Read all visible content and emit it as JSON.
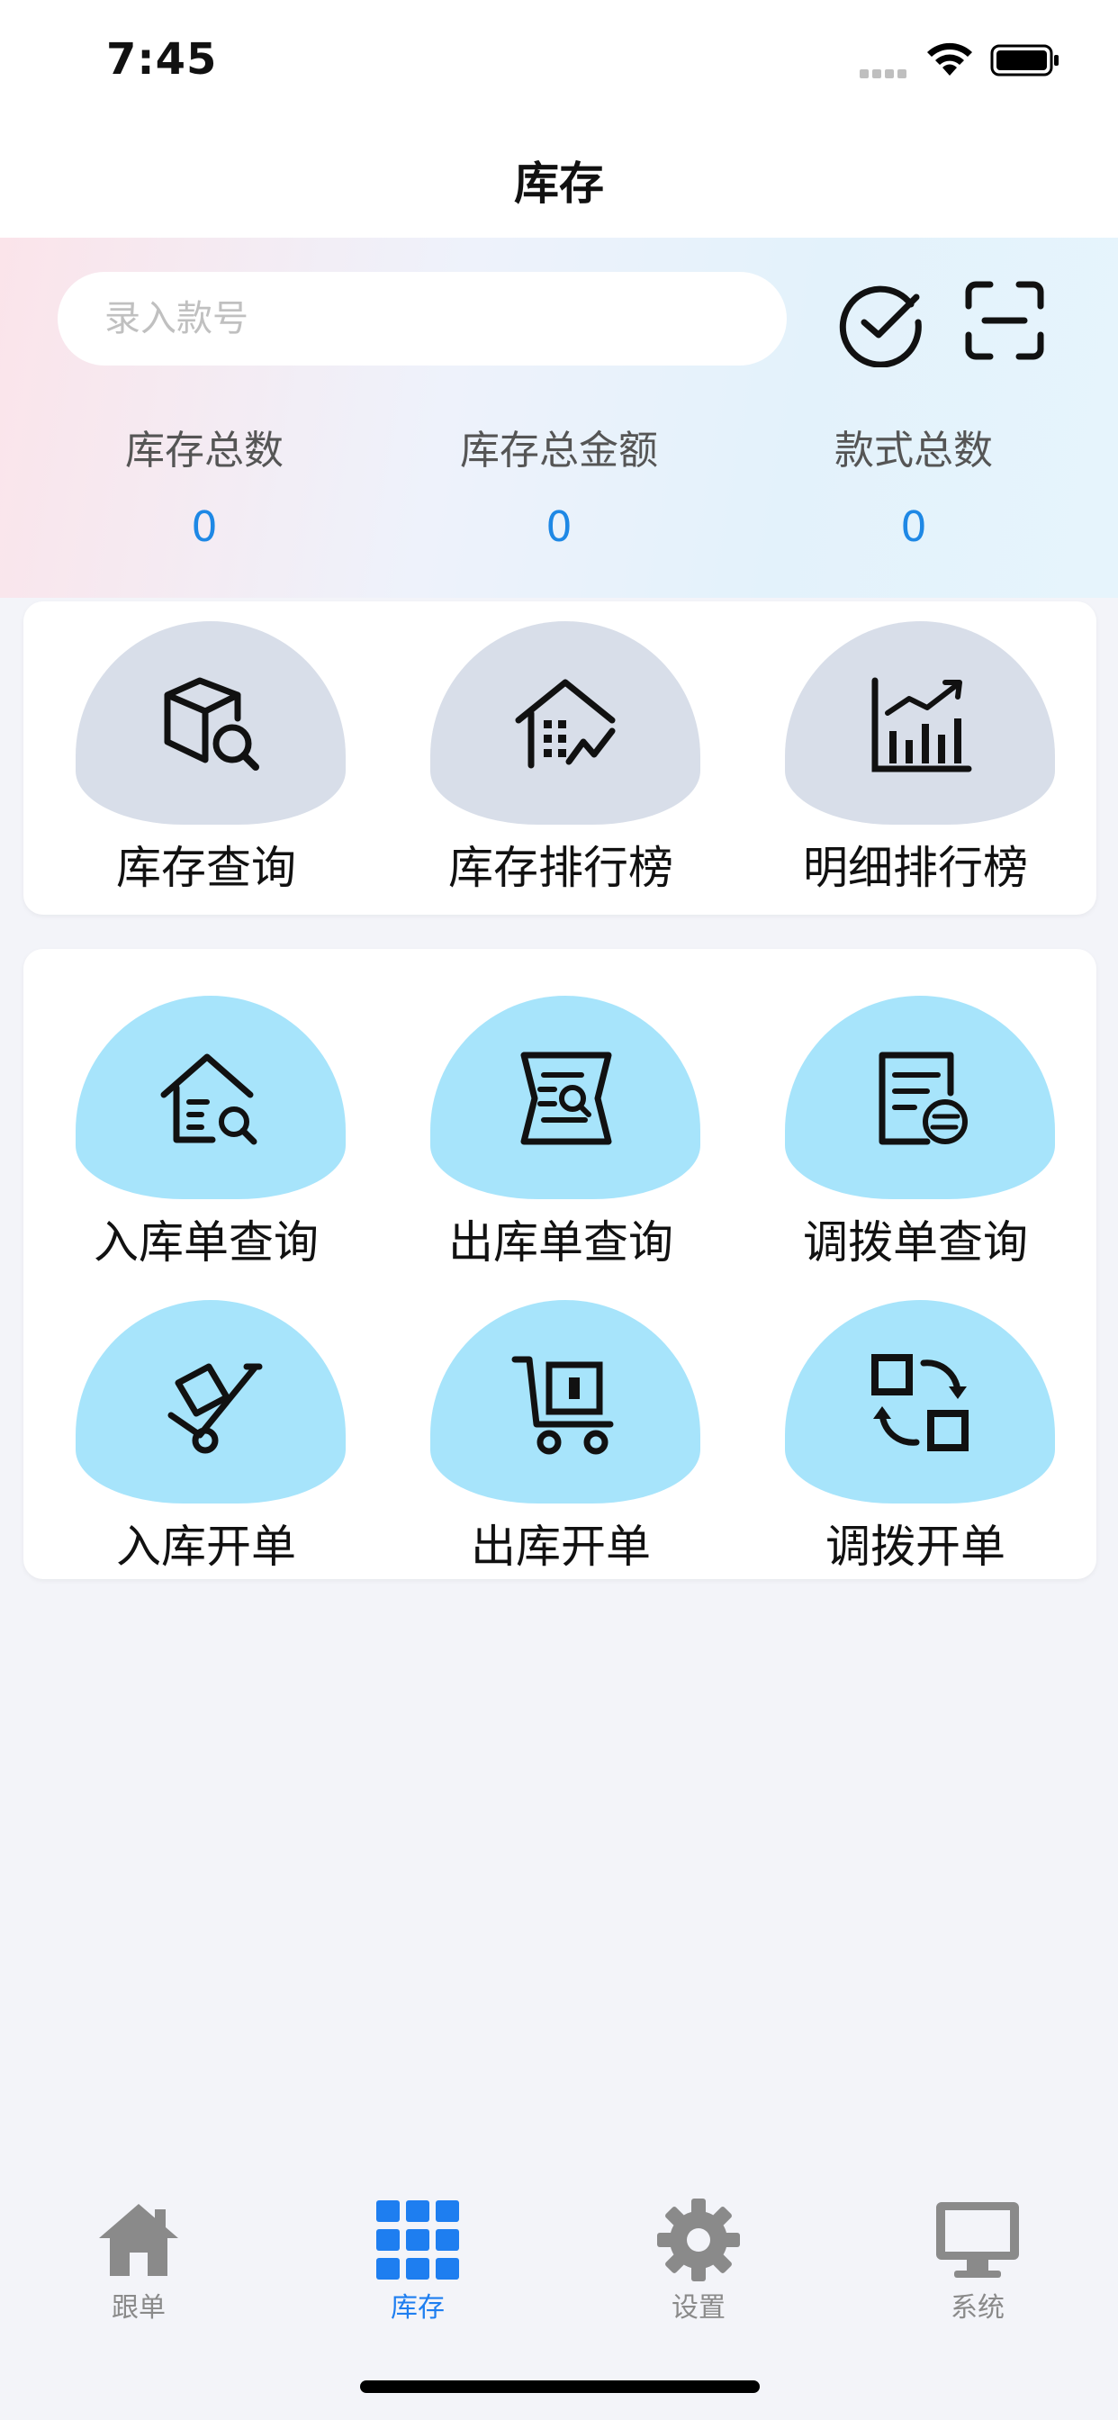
{
  "status_bar": {
    "time": "7:45"
  },
  "nav": {
    "title": "库存"
  },
  "search": {
    "placeholder": "录入款号",
    "value": ""
  },
  "actions": {
    "confirm_icon": "check-circle-icon",
    "scan_icon": "scan-icon"
  },
  "stats": [
    {
      "label": "库存总数",
      "value": "0"
    },
    {
      "label": "库存总金额",
      "value": "0"
    },
    {
      "label": "款式总数",
      "value": "0"
    }
  ],
  "section_reports": {
    "items": [
      {
        "label": "库存查询",
        "icon": "box-search-icon"
      },
      {
        "label": "库存排行榜",
        "icon": "building-chart-icon"
      },
      {
        "label": "明细排行榜",
        "icon": "bar-chart-icon"
      }
    ]
  },
  "section_orders": {
    "items": [
      {
        "label": "入库单查询",
        "icon": "house-search-icon"
      },
      {
        "label": "出库单查询",
        "icon": "document-search-icon"
      },
      {
        "label": "调拨单查询",
        "icon": "document-transfer-icon"
      },
      {
        "label": "入库开单",
        "icon": "hand-truck-icon"
      },
      {
        "label": "出库开单",
        "icon": "cart-icon"
      },
      {
        "label": "调拨开单",
        "icon": "swap-icon"
      }
    ]
  },
  "tab_bar": {
    "items": [
      {
        "label": "跟单",
        "icon": "home-icon",
        "active": false
      },
      {
        "label": "库存",
        "icon": "grid-icon",
        "active": true
      },
      {
        "label": "设置",
        "icon": "gear-icon",
        "active": false
      },
      {
        "label": "系统",
        "icon": "monitor-icon",
        "active": false
      }
    ]
  },
  "colors": {
    "accent": "#1e7ef0",
    "stat_value": "#1e88e5",
    "tile_grey": "#d8dee9",
    "tile_blue": "#a7e4fb",
    "tab_inactive": "#8a8a8a"
  }
}
